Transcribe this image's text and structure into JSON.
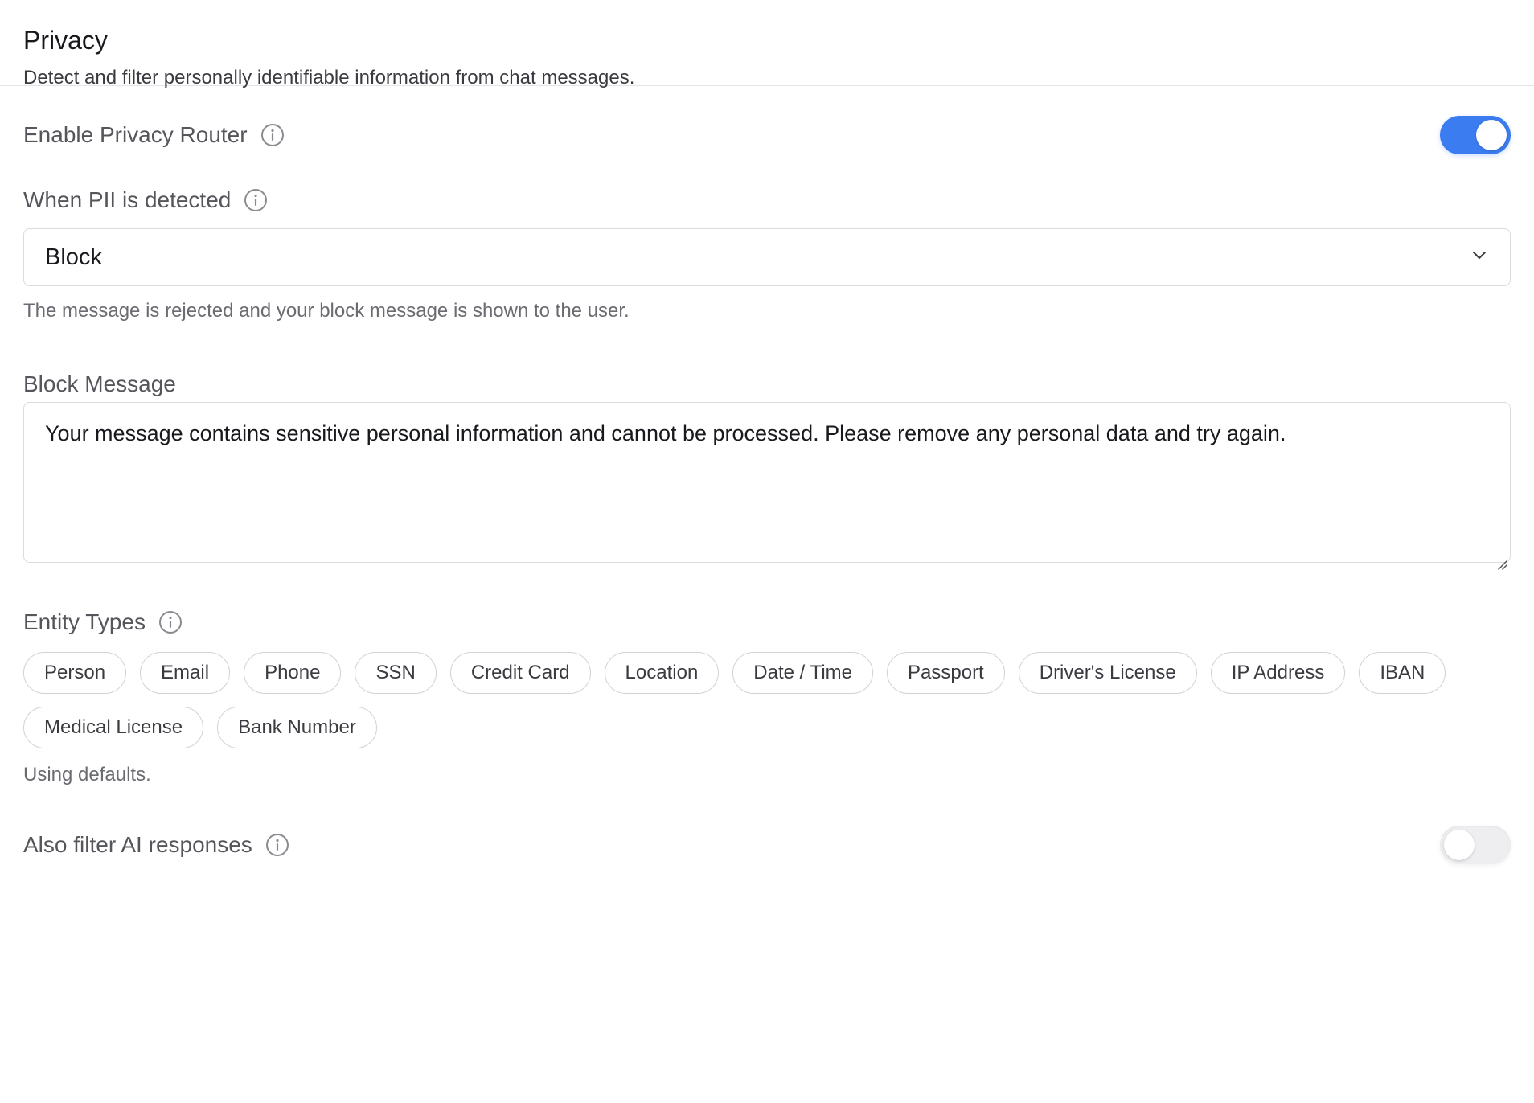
{
  "header": {
    "title": "Privacy",
    "description": "Detect and filter personally identifiable information from chat messages."
  },
  "privacy_router": {
    "label": "Enable Privacy Router",
    "enabled": true
  },
  "pii_action": {
    "label": "When PII is detected",
    "selected": "Block",
    "helper": "The message is rejected and your block message is shown to the user."
  },
  "block_message": {
    "label": "Block Message",
    "value": "Your message contains sensitive personal information and cannot be processed. Please remove any personal data and try again."
  },
  "entity_types": {
    "label": "Entity Types",
    "items": [
      "Person",
      "Email",
      "Phone",
      "SSN",
      "Credit Card",
      "Location",
      "Date / Time",
      "Passport",
      "Driver's License",
      "IP Address",
      "IBAN",
      "Medical License",
      "Bank Number"
    ],
    "helper": "Using defaults."
  },
  "filter_ai": {
    "label": "Also filter AI responses",
    "enabled": false
  },
  "colors": {
    "accent": "#3b7cf0",
    "toggle_off": "#eeeef0",
    "border": "#dcdce0"
  },
  "icons": {
    "info": "info-circle-icon",
    "dropdown": "chevron-down-icon",
    "resize": "resize-grip-icon"
  }
}
